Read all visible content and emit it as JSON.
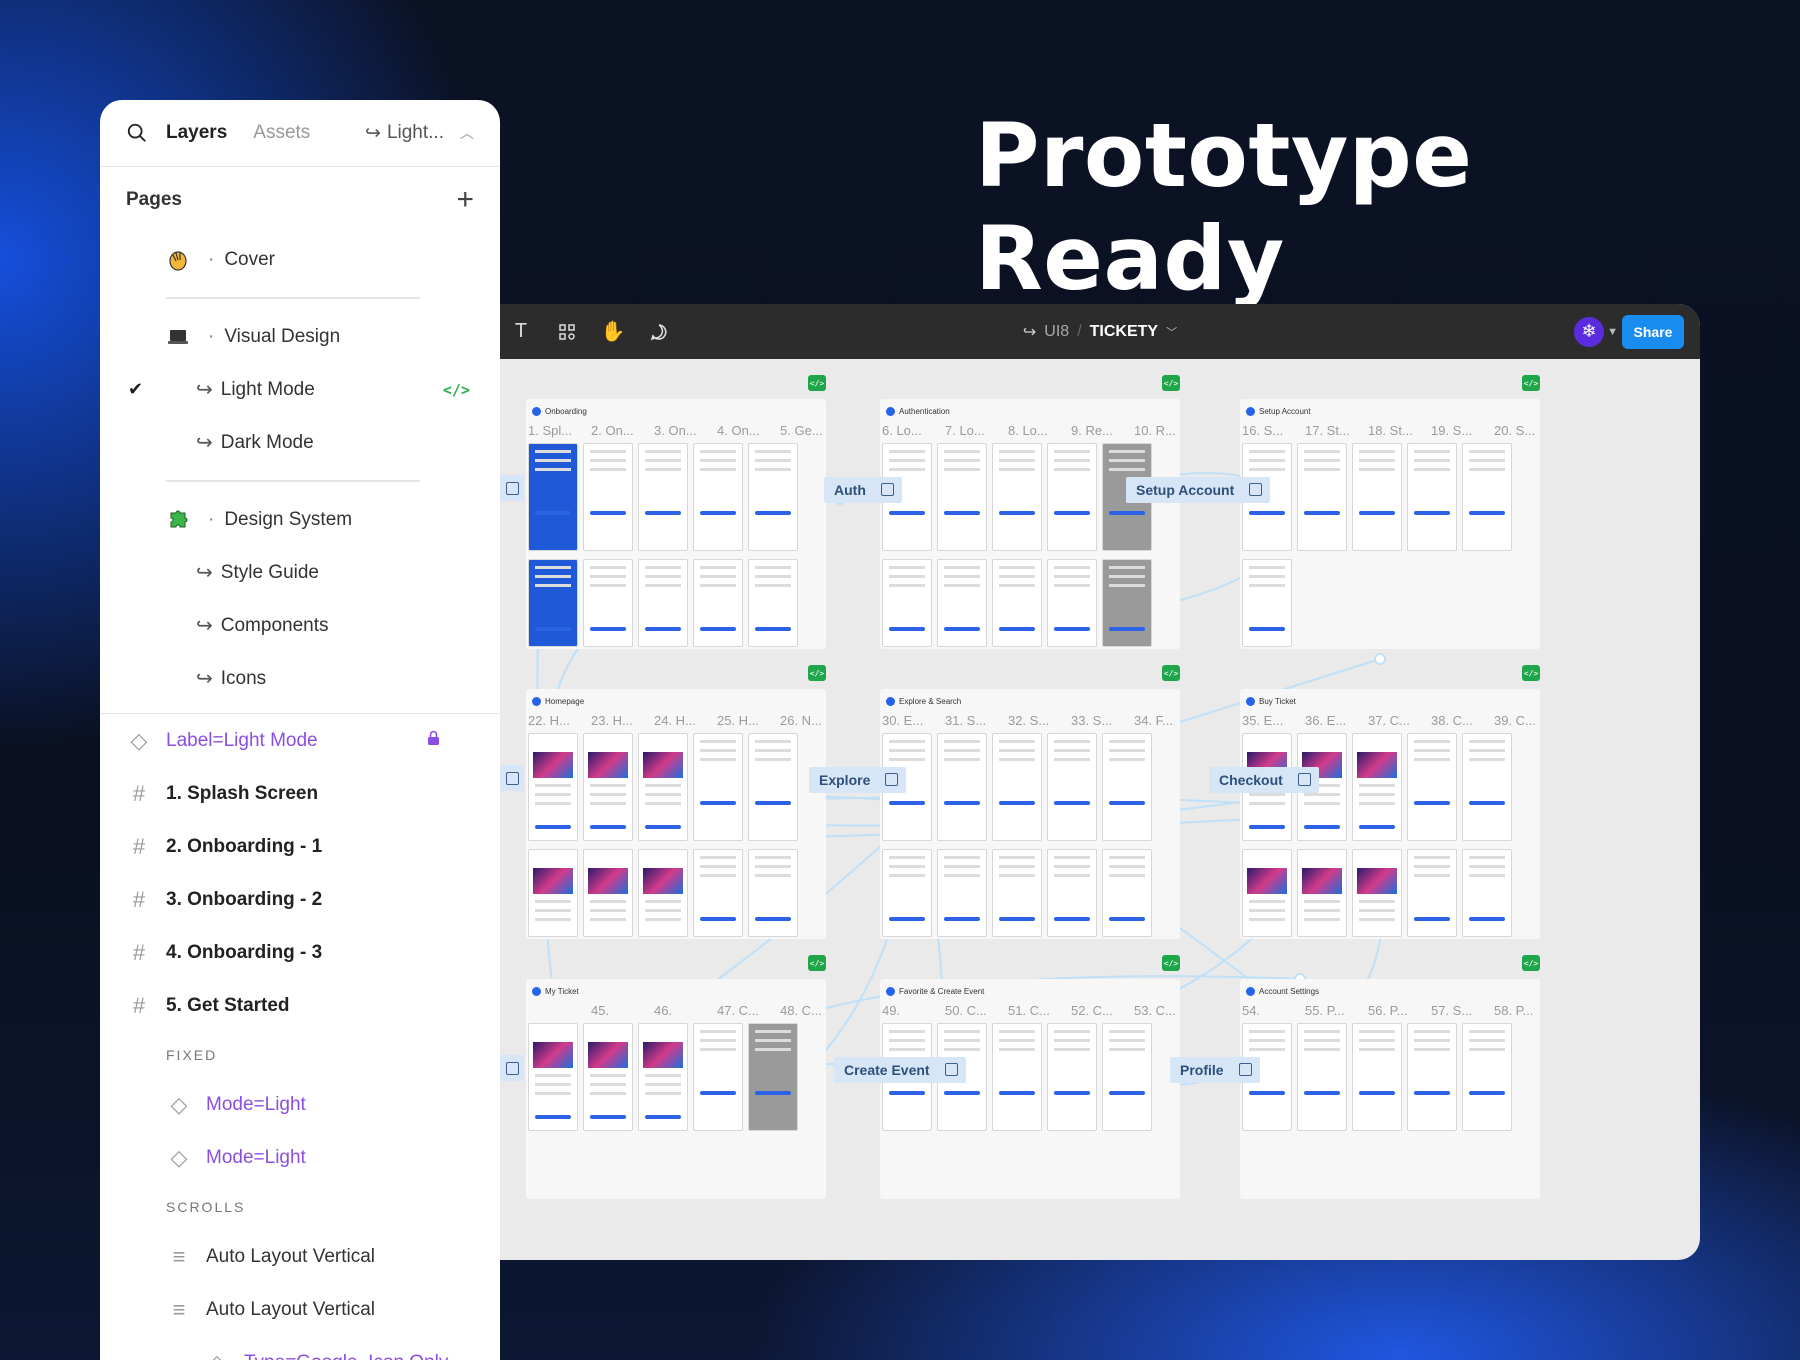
{
  "hero": {
    "title": "Prototype Ready"
  },
  "layers_panel": {
    "tabs": {
      "layers": "Layers",
      "assets": "Assets"
    },
    "page_switcher": "Light...",
    "pages_title": "Pages",
    "pages": [
      {
        "label": "Cover",
        "icon": "hand-wave-icon"
      },
      {
        "label": "Visual Design",
        "icon": "laptop-icon"
      },
      {
        "label": "Light Mode"
      },
      {
        "label": "Dark Mode"
      },
      {
        "label": "Design System",
        "icon": "puzzle-icon"
      },
      {
        "label": "Style Guide"
      },
      {
        "label": "Components"
      },
      {
        "label": "Icons"
      }
    ],
    "layers": {
      "component": "Label=Light Mode",
      "frames": [
        "1. Splash Screen",
        "2. Onboarding - 1",
        "3. Onboarding - 2",
        "4. Onboarding - 3",
        "5. Get Started"
      ],
      "fixed_label": "FIXED",
      "fixed_items": [
        "Mode=Light",
        "Mode=Light"
      ],
      "scrolls_label": "SCROLLS",
      "scroll_items": [
        "Auto Layout Vertical",
        "Auto Layout Vertical"
      ],
      "nested_item": "Type=Google, Icon Only..."
    },
    "colors": {
      "component_purple": "#8a4fe0",
      "code_green": "#2bb04a"
    }
  },
  "figma": {
    "project": "UI8",
    "file": "TICKETY",
    "share_label": "Share",
    "sections": [
      {
        "title": "Onboarding",
        "screens": [
          "1. Spl...",
          "2. On...",
          "3. On...",
          "4. On...",
          "5. Ge..."
        ]
      },
      {
        "title": "Authentication",
        "screens": [
          "6. Lo...",
          "7. Lo...",
          "8. Lo...",
          "9. Re...",
          "10. R..."
        ]
      },
      {
        "title": "Setup Account",
        "screens": [
          "16. S...",
          "17. St...",
          "18. St...",
          "19. S...",
          "20. S..."
        ]
      },
      {
        "title": "Homepage",
        "screens": [
          "22. H...",
          "23. H...",
          "24. H...",
          "25. H...",
          "26. N..."
        ]
      },
      {
        "title": "Explore & Search",
        "screens": [
          "30. E...",
          "31. S...",
          "32. S...",
          "33. S...",
          "34. F..."
        ]
      },
      {
        "title": "Buy Ticket",
        "screens": [
          "35. E...",
          "36. E...",
          "37. C...",
          "38. C...",
          "39. C..."
        ]
      },
      {
        "title": "My Ticket",
        "screens": [
          "",
          "45.",
          "46.",
          "47. C...",
          "48. C..."
        ]
      },
      {
        "title": "Favorite & Create Event",
        "screens": [
          "49.",
          "50. C...",
          "51. C...",
          "52. C...",
          "53. C..."
        ]
      },
      {
        "title": "Account Settings",
        "screens": [
          "54.",
          "55. P...",
          "56. P...",
          "57. S...",
          "58. P..."
        ]
      }
    ],
    "flow_chips": [
      "Auth",
      "Setup Account",
      "Explore",
      "Checkout",
      "Create Event",
      "Profile"
    ],
    "colors": {
      "accent": "#1a8cf0",
      "link_line": "#bfe0f7",
      "section_code": "#1fa64a"
    }
  }
}
